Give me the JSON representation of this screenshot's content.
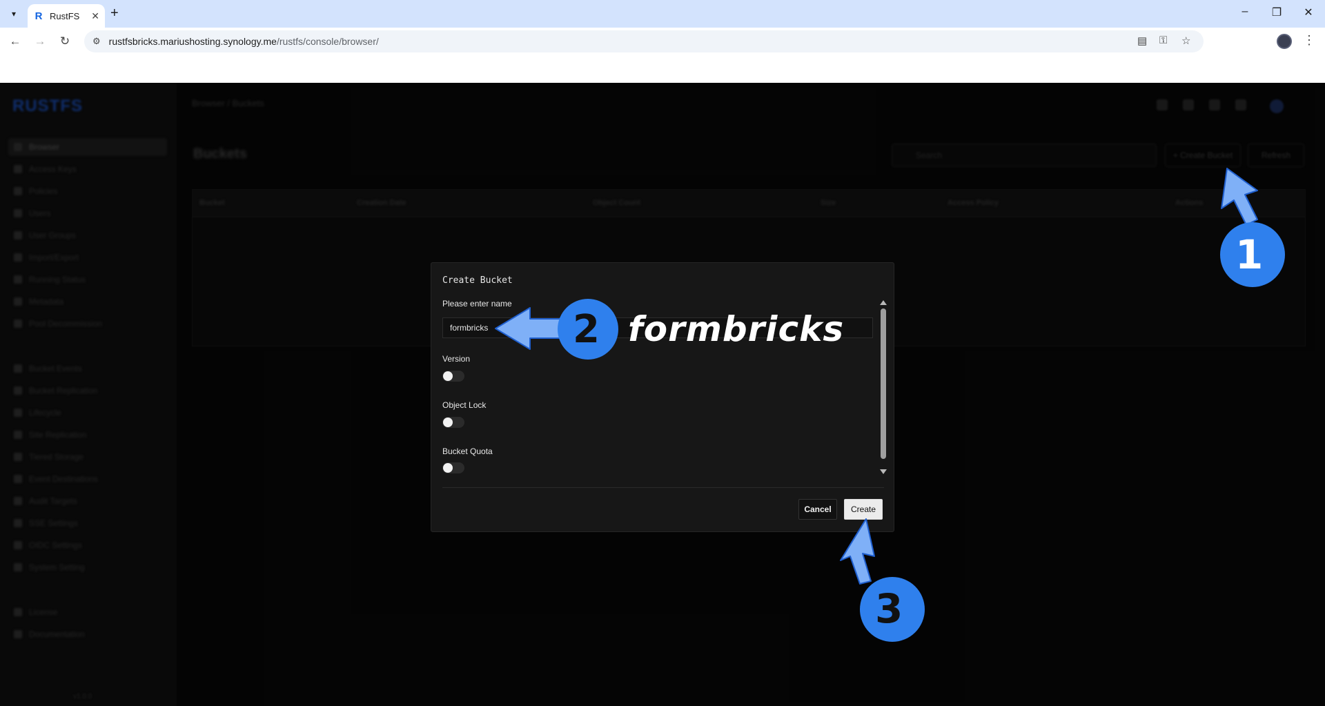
{
  "browser": {
    "tab_title": "RustFS",
    "favicon_letter": "R",
    "url_host": "rustfsbricks.mariushosting.synology.me",
    "url_path": "/rustfs/console/browser/"
  },
  "app": {
    "logo_text": "RUSTFS",
    "breadcrumb": "Browser  /  Buckets",
    "page_heading": "Buckets",
    "search_placeholder": "Search",
    "create_bucket_label": "+ Create Bucket",
    "refresh_label": "Refresh",
    "version_footer": "v1.0.0",
    "sidebar": {
      "items": [
        {
          "label": "Browser",
          "active": true
        },
        {
          "label": "Access Keys"
        },
        {
          "label": "Policies"
        },
        {
          "label": "Users"
        },
        {
          "label": "User Groups"
        },
        {
          "label": "Import/Export"
        },
        {
          "label": "Running Status"
        },
        {
          "label": "Metadata"
        },
        {
          "label": "Pool Decommission"
        },
        {
          "label": "Bucket Events"
        },
        {
          "label": "Bucket Replication"
        },
        {
          "label": "Lifecycle"
        },
        {
          "label": "Site Replication"
        },
        {
          "label": "Tiered Storage"
        },
        {
          "label": "Event Destinations"
        },
        {
          "label": "Audit Targets"
        },
        {
          "label": "SSE Settings"
        },
        {
          "label": "OIDC Settings"
        },
        {
          "label": "System Setting"
        },
        {
          "label": "License"
        },
        {
          "label": "Documentation"
        }
      ]
    },
    "table_headers": [
      "Bucket",
      "Creation Date",
      "Object Count",
      "Size",
      "Access Policy",
      "Actions"
    ]
  },
  "modal": {
    "title": "Create Bucket",
    "name_label": "Please enter name",
    "name_value": "formbricks",
    "version_label": "Version",
    "object_lock_label": "Object Lock",
    "bucket_quota_label": "Bucket Quota",
    "cancel_label": "Cancel",
    "create_label": "Create"
  },
  "annotations": {
    "step1": "1",
    "step2": "2",
    "step3": "3",
    "overlay_word": "formbricks",
    "badge_color": "#2f80ed",
    "arrow_color": "#7fb0f7"
  }
}
